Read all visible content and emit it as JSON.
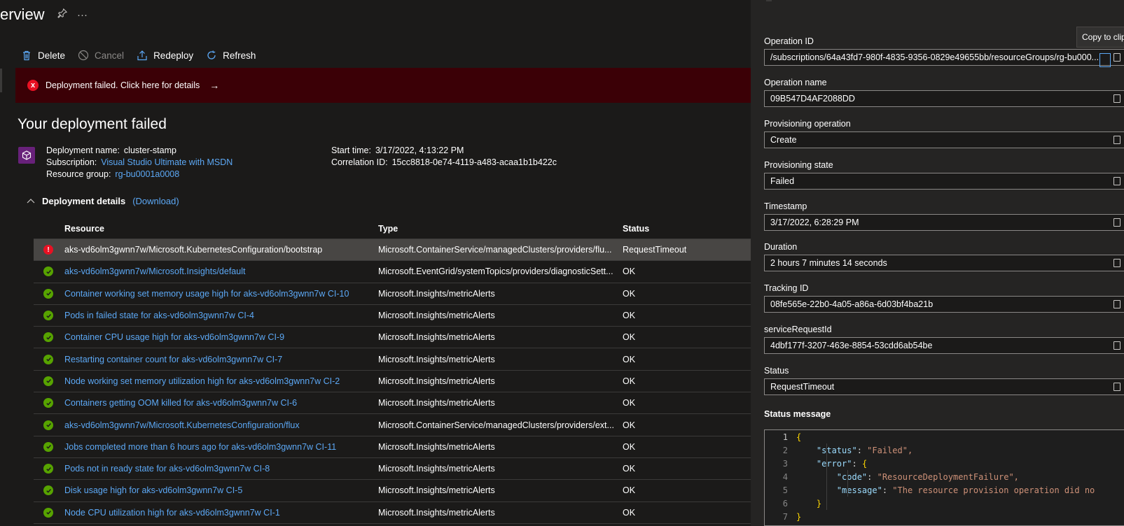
{
  "page": {
    "title": "erview",
    "pin_icon": "pin-icon",
    "more_icon": "ellipsis-icon",
    "more_text": "···"
  },
  "toolbar": {
    "delete_label": "Delete",
    "cancel_label": "Cancel",
    "redeploy_label": "Redeploy",
    "refresh_label": "Refresh"
  },
  "banner": {
    "text": "Deployment failed. Click here for details",
    "arrow": "→",
    "icon": "x",
    "bg_color": "#3b0006"
  },
  "deployment": {
    "heading": "Your deployment failed",
    "name_label": "Deployment name:",
    "name_value": "cluster-stamp",
    "subscription_label": "Subscription:",
    "subscription_value": "Visual Studio Ultimate with MSDN",
    "rg_label": "Resource group:",
    "rg_value": "rg-bu0001a0008",
    "start_label": "Start time:",
    "start_value": "3/17/2022, 4:13:22 PM",
    "correlation_label": "Correlation ID:",
    "correlation_value": "15cc8818-0e74-4119-a483-acaa1b1b422c"
  },
  "details": {
    "title": "Deployment details",
    "download_label": "(Download)",
    "columns": [
      "Resource",
      "Type",
      "Status"
    ],
    "rows": [
      {
        "status_icon": "error",
        "resource": "aks-vd6olm3gwnn7w/Microsoft.KubernetesConfiguration/bootstrap",
        "link": false,
        "type": "Microsoft.ContainerService/managedClusters/providers/flu...",
        "status": "RequestTimeout",
        "selected": true
      },
      {
        "status_icon": "ok",
        "resource": "aks-vd6olm3gwnn7w/Microsoft.Insights/default",
        "link": true,
        "type": "Microsoft.EventGrid/systemTopics/providers/diagnosticSett...",
        "status": "OK"
      },
      {
        "status_icon": "ok",
        "resource": "Container working set memory usage high for aks-vd6olm3gwnn7w CI-10",
        "link": true,
        "type": "Microsoft.Insights/metricAlerts",
        "status": "OK"
      },
      {
        "status_icon": "ok",
        "resource": "Pods in failed state for aks-vd6olm3gwnn7w CI-4",
        "link": true,
        "type": "Microsoft.Insights/metricAlerts",
        "status": "OK"
      },
      {
        "status_icon": "ok",
        "resource": "Container CPU usage high for aks-vd6olm3gwnn7w CI-9",
        "link": true,
        "type": "Microsoft.Insights/metricAlerts",
        "status": "OK"
      },
      {
        "status_icon": "ok",
        "resource": "Restarting container count for aks-vd6olm3gwnn7w CI-7",
        "link": true,
        "type": "Microsoft.Insights/metricAlerts",
        "status": "OK"
      },
      {
        "status_icon": "ok",
        "resource": "Node working set memory utilization high for aks-vd6olm3gwnn7w CI-2",
        "link": true,
        "type": "Microsoft.Insights/metricAlerts",
        "status": "OK"
      },
      {
        "status_icon": "ok",
        "resource": "Containers getting OOM killed for aks-vd6olm3gwnn7w CI-6",
        "link": true,
        "type": "Microsoft.Insights/metricAlerts",
        "status": "OK"
      },
      {
        "status_icon": "ok",
        "resource": "aks-vd6olm3gwnn7w/Microsoft.KubernetesConfiguration/flux",
        "link": true,
        "type": "Microsoft.ContainerService/managedClusters/providers/ext...",
        "status": "OK"
      },
      {
        "status_icon": "ok",
        "resource": "Jobs completed more than 6 hours ago for aks-vd6olm3gwnn7w CI-11",
        "link": true,
        "type": "Microsoft.Insights/metricAlerts",
        "status": "OK"
      },
      {
        "status_icon": "ok",
        "resource": "Pods not in ready state for aks-vd6olm3gwnn7w CI-8",
        "link": true,
        "type": "Microsoft.Insights/metricAlerts",
        "status": "OK"
      },
      {
        "status_icon": "ok",
        "resource": "Disk usage high for aks-vd6olm3gwnn7w CI-5",
        "link": true,
        "type": "Microsoft.Insights/metricAlerts",
        "status": "OK"
      },
      {
        "status_icon": "ok",
        "resource": "Node CPU utilization high for aks-vd6olm3gwnn7w CI-1",
        "link": true,
        "type": "Microsoft.Insights/metricAlerts",
        "status": "OK"
      }
    ]
  },
  "operation": {
    "tooltip": "Copy to clipboard",
    "fields": [
      {
        "label": "Operation ID",
        "value": "/subscriptions/64a43fd7-980f-4835-9356-0829e49655bb/resourceGroups/rg-bu000..."
      },
      {
        "label": "Operation name",
        "value": "09B547D4AF2088DD"
      },
      {
        "label": "Provisioning operation",
        "value": "Create"
      },
      {
        "label": "Provisioning state",
        "value": "Failed"
      },
      {
        "label": "Timestamp",
        "value": "3/17/2022, 6:28:29 PM"
      },
      {
        "label": "Duration",
        "value": "2 hours 7 minutes 14 seconds"
      },
      {
        "label": "Tracking ID",
        "value": "08fe565e-22b0-4a05-a86a-6d03bf4ba21b"
      },
      {
        "label": "serviceRequestId",
        "value": "4dbf177f-3207-463e-8854-53cdd6ab54be"
      },
      {
        "label": "Status",
        "value": "RequestTimeout"
      }
    ],
    "status_message_label": "Status message",
    "code_lines": [
      {
        "n": "1",
        "text": "{"
      },
      {
        "n": "2",
        "key": "\"status\"",
        "val": "\"Failed\","
      },
      {
        "n": "3",
        "key": "\"error\"",
        "val": "{"
      },
      {
        "n": "4",
        "key": "\"code\"",
        "val": "\"ResourceDeploymentFailure\","
      },
      {
        "n": "5",
        "key": "\"message\"",
        "val": "\"The resource provision operation did no"
      },
      {
        "n": "6",
        "text": "}"
      },
      {
        "n": "7",
        "text": "}"
      }
    ]
  },
  "colors": {
    "link": "#5ca8f5",
    "ok": "#57a300",
    "error": "#e81123",
    "banner": "#3b0006",
    "panel": "#252423",
    "background": "#1b1a19"
  }
}
